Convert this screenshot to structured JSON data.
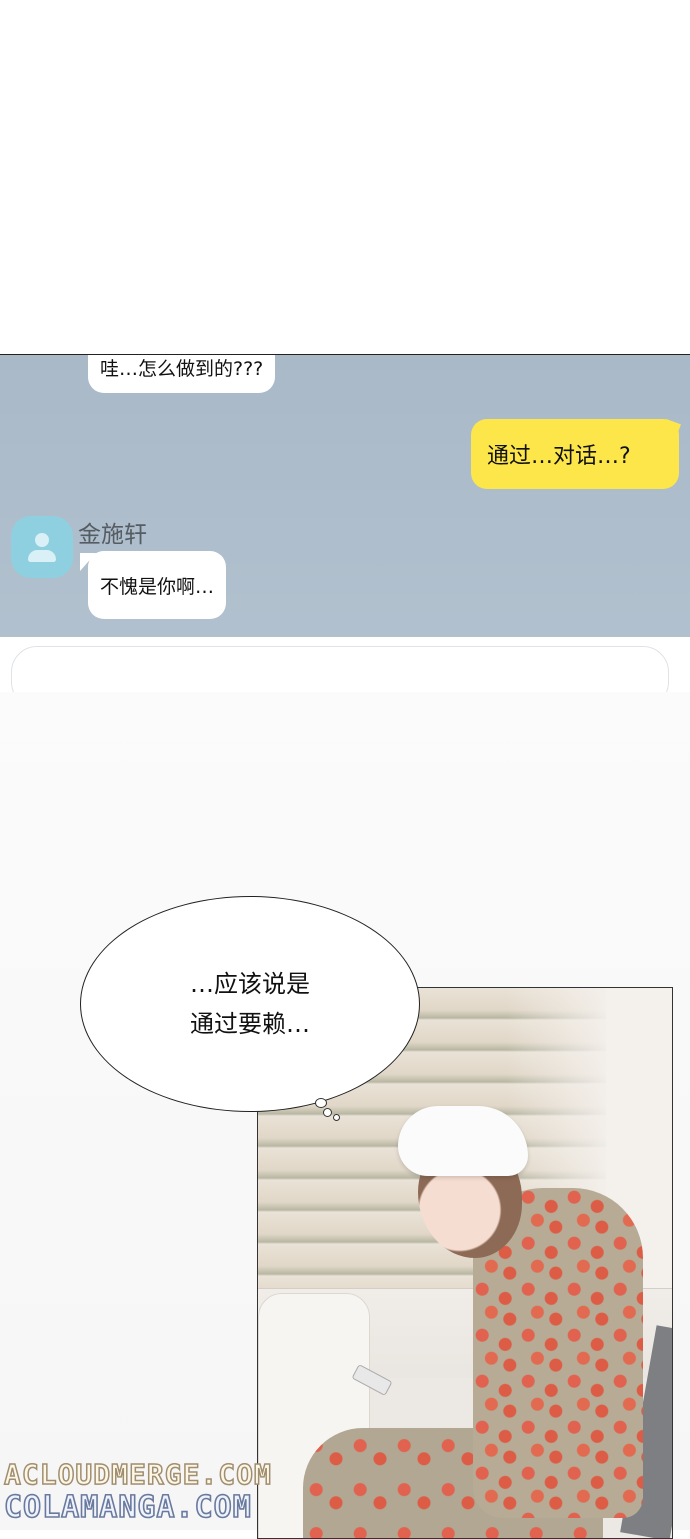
{
  "chat": {
    "messages": [
      {
        "sender": "other",
        "text": "哇…怎么做到的???"
      },
      {
        "sender": "me",
        "text": "通过…对话…?"
      },
      {
        "sender": "other",
        "name": "金施轩",
        "text": "不愧是你啊…"
      }
    ],
    "colors": {
      "background": "#a9b9c8",
      "my_bubble": "#fde64a",
      "their_bubble": "#ffffff",
      "avatar": "#8fd0e0"
    },
    "avatar_icon": "user-silhouette-icon"
  },
  "thought": {
    "line1": "…应该说是",
    "line2": "通过要赖…"
  },
  "watermarks": {
    "line1": "ACLOUDMERGE.COM",
    "line2": "COLAMANGA.COM"
  }
}
